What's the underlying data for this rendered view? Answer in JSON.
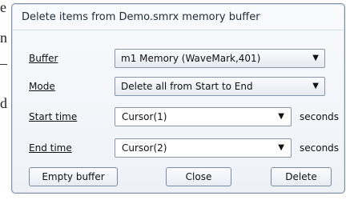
{
  "background": {
    "left_chars": [
      "e",
      "n",
      "–",
      "d"
    ]
  },
  "dialog": {
    "title": "Delete items from Demo.smrx memory buffer",
    "fields": {
      "buffer": {
        "label": "Buffer",
        "value": "m1 Memory (WaveMark,401)"
      },
      "mode": {
        "label": "Mode",
        "value": "Delete all from Start to End"
      },
      "start_time": {
        "label": "Start time",
        "value": "Cursor(1)",
        "unit": "seconds"
      },
      "end_time": {
        "label": "End time",
        "value": "Cursor(2)",
        "unit": "seconds"
      }
    },
    "buttons": {
      "empty_buffer": "Empty buffer",
      "close": "Close",
      "delete": "Delete"
    }
  },
  "icons": {
    "dropdown": "chevron-down-icon"
  }
}
